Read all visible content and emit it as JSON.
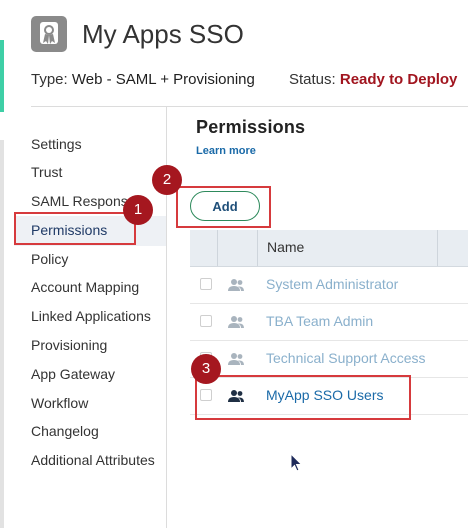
{
  "app": {
    "title": "My Apps SSO",
    "type_label": "Type:",
    "type_value": "Web - SAML + Provisioning",
    "status_label": "Status:",
    "status_value": "Ready to Deploy",
    "icon": "ribbon-award-icon"
  },
  "sidebar": {
    "items": [
      {
        "label": "Settings"
      },
      {
        "label": "Trust"
      },
      {
        "label": "SAML Response"
      },
      {
        "label": "Permissions",
        "active": true
      },
      {
        "label": "Policy"
      },
      {
        "label": "Account Mapping"
      },
      {
        "label": "Linked Applications"
      },
      {
        "label": "Provisioning"
      },
      {
        "label": "App Gateway"
      },
      {
        "label": "Workflow"
      },
      {
        "label": "Changelog"
      },
      {
        "label": "Additional Attributes"
      }
    ]
  },
  "permissions": {
    "title": "Permissions",
    "learn_more": "Learn more",
    "add_label": "Add",
    "columns": [
      "Name"
    ],
    "rows": [
      {
        "name": "System Administrator",
        "icon": "users-icon"
      },
      {
        "name": "TBA Team Admin",
        "icon": "users-icon"
      },
      {
        "name": "Technical Support Access",
        "icon": "users-icon"
      },
      {
        "name": "MyApp SSO Users",
        "icon": "users-icon",
        "active": true
      }
    ]
  },
  "annotations": {
    "badge1": "1",
    "badge2": "2",
    "badge3": "3"
  },
  "colors": {
    "accent_green": "#3ecfa6",
    "status_red": "#a1151f",
    "badge_red": "#a5171f",
    "highlight_red": "#d63a3d",
    "link_blue": "#1a6aa8"
  }
}
